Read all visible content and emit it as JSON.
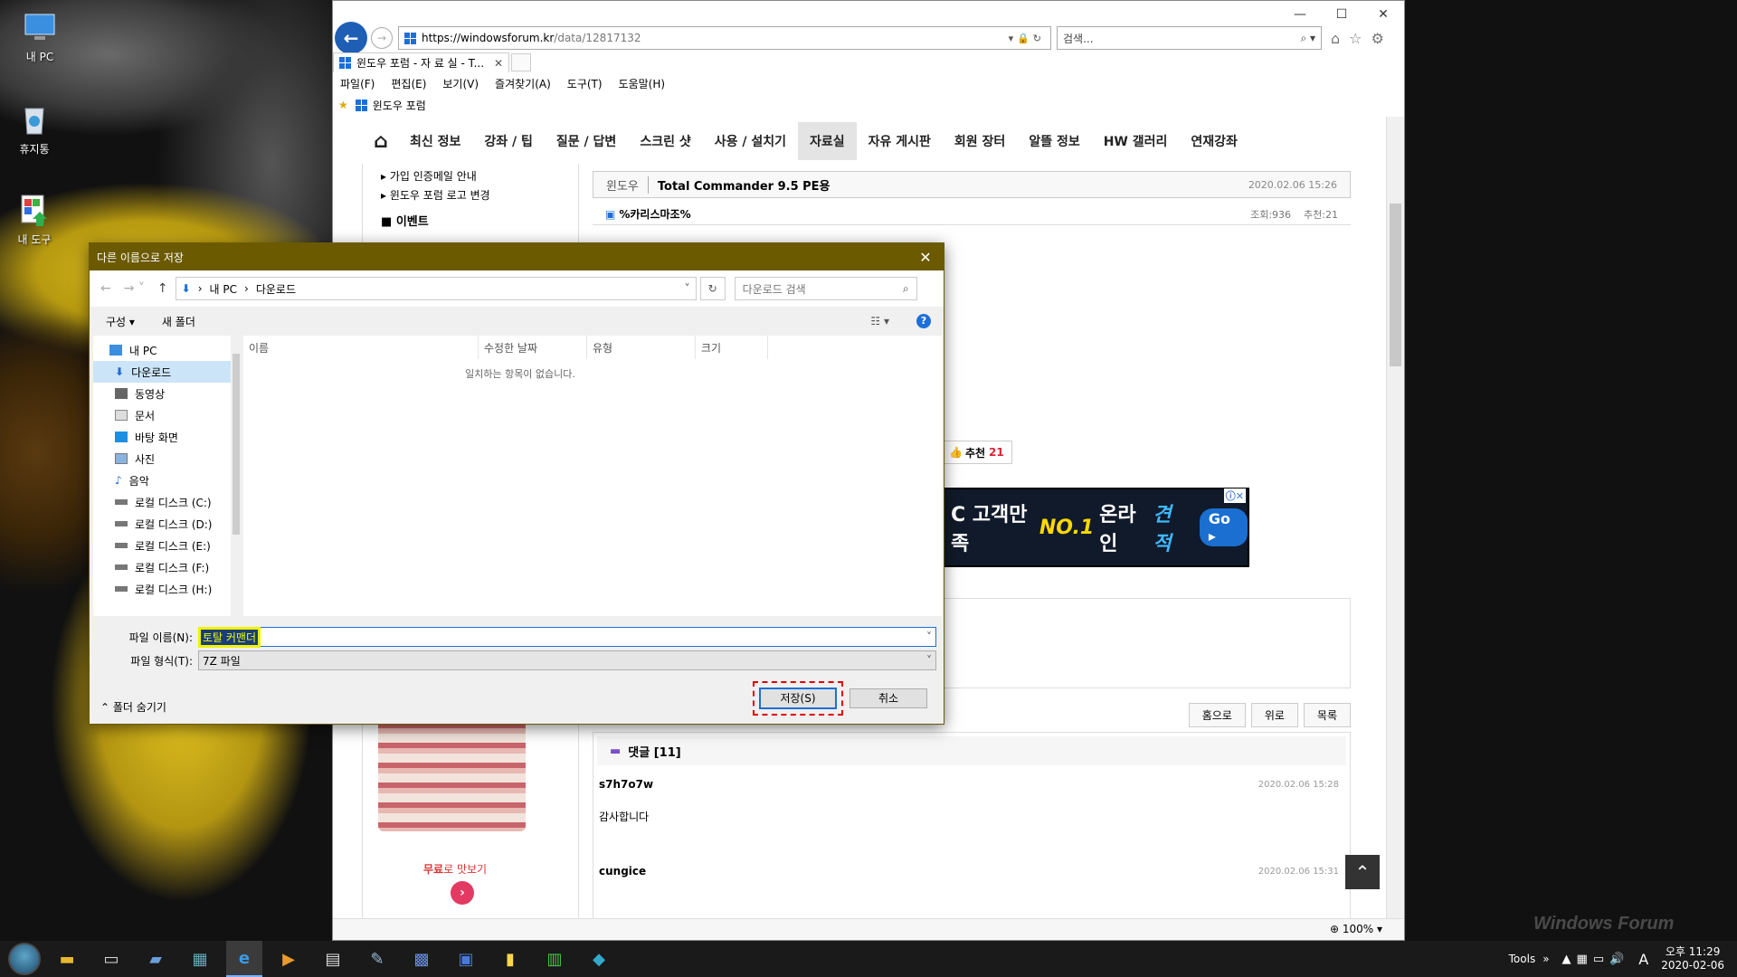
{
  "desktop": {
    "icons": [
      {
        "label": "내 PC",
        "icon": "computer-icon"
      },
      {
        "label": "휴지통",
        "icon": "recycle-bin-icon"
      },
      {
        "label": "내 도구",
        "icon": "tools-folder-icon"
      }
    ]
  },
  "browser": {
    "url_main": "https://windowsforum.kr",
    "url_path": "/data/12817132",
    "search_placeholder": "검색...",
    "tab_title": "윈도우 포럼 - 자 료 실 - T...",
    "menu": [
      "파일(F)",
      "편집(E)",
      "보기(V)",
      "즐겨찾기(A)",
      "도구(T)",
      "도움말(H)"
    ],
    "favorite": "윈도우 포럼",
    "zoom": "100%"
  },
  "site": {
    "nav": [
      "최신 정보",
      "강좌 / 팁",
      "질문 / 답변",
      "스크린 샷",
      "사용 / 설치기",
      "자료실",
      "자유 게시판",
      "회원 장터",
      "알뜰 정보",
      "HW 갤러리",
      "연재강좌"
    ],
    "active_nav": "자료실",
    "sidebar_links": [
      "가입 인증메일 안내",
      "윈도우 포럼 로고 변경"
    ],
    "sidebar_section": "이벤트",
    "post": {
      "category": "윈도우",
      "title": "Total Commander 9.5 PE용",
      "date": "2020.02.06 15:26",
      "author": "%카리스마조%",
      "views": "조회:936",
      "recommends": "추천:21"
    },
    "rec_label": "추천",
    "rec_count": "21",
    "ad": {
      "prefix": "C 고객만족",
      "no1": "NO.1",
      "mid": "온라인",
      "hl": "견적",
      "go": "Go"
    },
    "buttons": [
      "홈으로",
      "위로",
      "목록"
    ],
    "comments_header": "댓글 [11]",
    "comments": [
      {
        "author": "s7h7o7w",
        "date": "2020.02.06 15:28",
        "text": "감사합니다"
      },
      {
        "author": "cungice",
        "date": "2020.02.06 15:31",
        "text": ""
      }
    ],
    "promo_text_red": "무료",
    "promo_text": "로 맛보기"
  },
  "dialog": {
    "title": "다른 이름으로 저장",
    "breadcrumb": [
      "내 PC",
      "다운로드"
    ],
    "search_placeholder": "다운로드 검색",
    "organize": "구성 ▾",
    "new_folder": "새 폴더",
    "tree": [
      {
        "label": "내 PC",
        "icon": "computer-icon"
      },
      {
        "label": "다운로드",
        "icon": "download-icon"
      },
      {
        "label": "동영상",
        "icon": "video-icon"
      },
      {
        "label": "문서",
        "icon": "document-icon"
      },
      {
        "label": "바탕 화면",
        "icon": "desktop-icon"
      },
      {
        "label": "사진",
        "icon": "picture-icon"
      },
      {
        "label": "음악",
        "icon": "music-icon"
      },
      {
        "label": "로컬 디스크 (C:)",
        "icon": "drive-icon"
      },
      {
        "label": "로컬 디스크 (D:)",
        "icon": "drive-icon"
      },
      {
        "label": "로컬 디스크 (E:)",
        "icon": "drive-icon"
      },
      {
        "label": "로컬 디스크 (F:)",
        "icon": "drive-icon"
      },
      {
        "label": "로컬 디스크 (H:)",
        "icon": "drive-icon"
      }
    ],
    "columns": [
      "이름",
      "수정한 날짜",
      "유형",
      "크기"
    ],
    "empty_message": "일치하는 항목이 없습니다.",
    "filename_label": "파일 이름(N):",
    "filename_value": "토탈 커맨더",
    "filetype_label": "파일 형식(T):",
    "filetype_value": "7Z 파일",
    "hide_folders": "폴더 숨기기",
    "save": "저장(S)",
    "cancel": "취소"
  },
  "taskbar": {
    "tools_label": "Tools",
    "time": "오후 11:29",
    "date": "2020-02-06",
    "ime": "A"
  },
  "watermark": "Windows Forum"
}
